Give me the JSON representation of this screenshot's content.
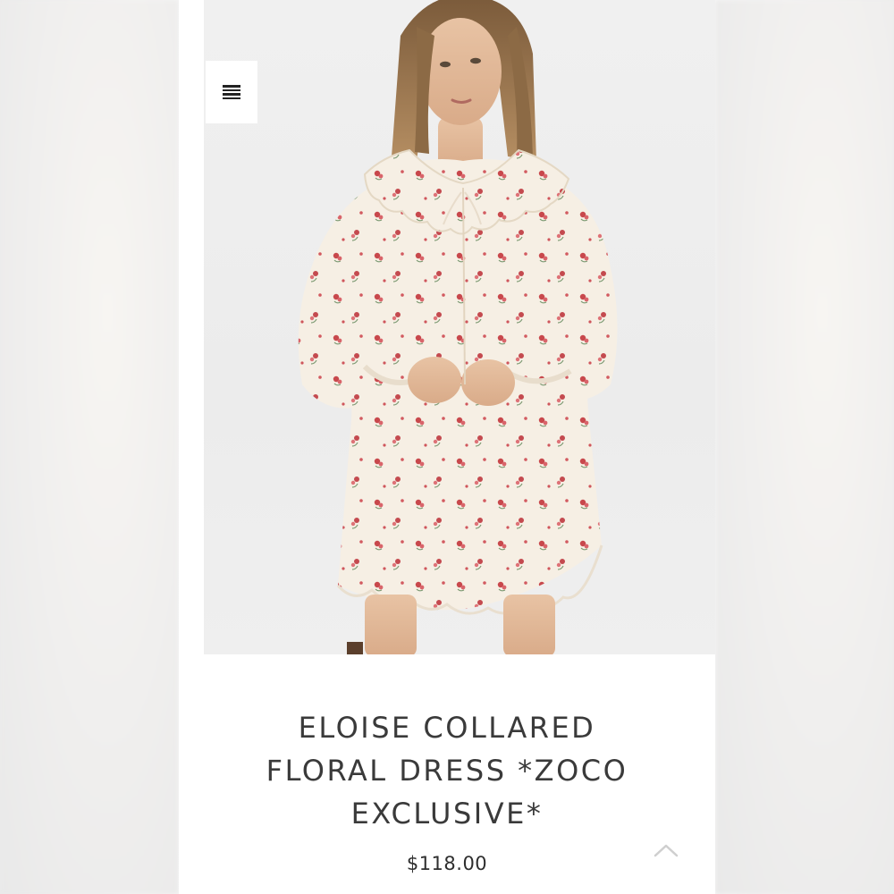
{
  "navigation": {
    "menu_icon": "hamburger-menu-icon",
    "scroll_top_icon": "chevron-up-icon"
  },
  "product": {
    "image_subject": "model wearing cream floral dress with scalloped collar",
    "title": "ELOISE COLLARED FLORAL DRESS *ZOCO EXCLUSIVE*",
    "price": "$118.00"
  },
  "colors": {
    "background": "#ffffff",
    "title_text": "#3a3a3a",
    "price_text": "#2e2e2e",
    "dress_base": "#f6efe4",
    "floral_accent": "#c8484c"
  }
}
